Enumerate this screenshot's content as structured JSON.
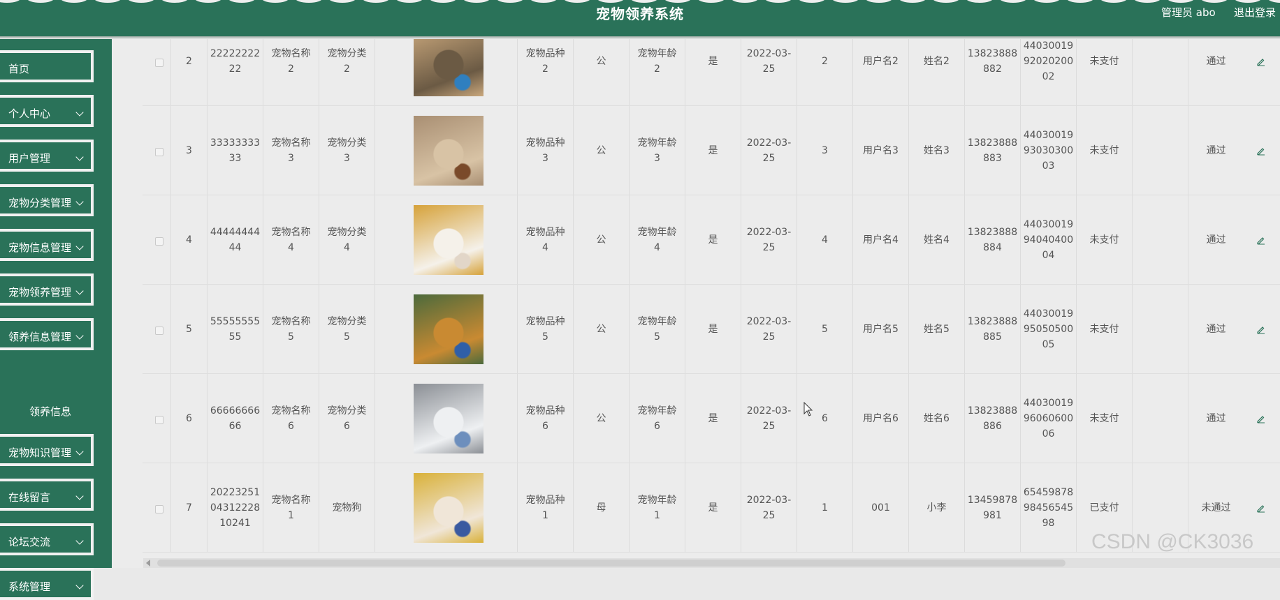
{
  "header": {
    "title": "宠物领养系统",
    "user_label": "管理员 abo",
    "logout_label": "退出登录",
    "bg_color": "#2a7259"
  },
  "sidebar": {
    "items": [
      {
        "label": "首页",
        "has_chevron": false
      },
      {
        "label": "个人中心",
        "has_chevron": true
      },
      {
        "label": "用户管理",
        "has_chevron": true
      },
      {
        "label": "宠物分类管理",
        "has_chevron": true
      },
      {
        "label": "宠物信息管理",
        "has_chevron": true
      },
      {
        "label": "宠物领养管理",
        "has_chevron": true
      },
      {
        "label": "领养信息管理",
        "has_chevron": true
      },
      {
        "label": "宠物知识管理",
        "has_chevron": true
      },
      {
        "label": "在线留言",
        "has_chevron": true
      },
      {
        "label": "论坛交流",
        "has_chevron": true
      },
      {
        "label": "系统管理",
        "has_chevron": true
      }
    ],
    "sub_item": "领养信息"
  },
  "table": {
    "rows": [
      {
        "idx": "2",
        "no": "22222222\n22",
        "name": "宠物名称\n2",
        "category": "宠物分类\n2",
        "image": "dog-ball-photo",
        "breed": "宠物品种\n2",
        "sex": "公",
        "age": "宠物年龄\n2",
        "vaccinated": "是",
        "date": "2022-03-\n25",
        "count": "2",
        "username": "用户名2",
        "realname": "姓名2",
        "phone": "13823888\n882",
        "idcard": "44030019\n92020200\n02",
        "pay": "未支付",
        "review": "通过"
      },
      {
        "idx": "3",
        "no": "33333333\n33",
        "name": "宠物名称\n3",
        "category": "宠物分类\n3",
        "image": "dog-sleeping-photo",
        "breed": "宠物品种\n3",
        "sex": "公",
        "age": "宠物年龄\n3",
        "vaccinated": "是",
        "date": "2022-03-\n25",
        "count": "3",
        "username": "用户名3",
        "realname": "姓名3",
        "phone": "13823888\n883",
        "idcard": "44030019\n93030300\n03",
        "pay": "未支付",
        "review": "通过"
      },
      {
        "idx": "4",
        "no": "44444444\n44",
        "name": "宠物名称\n4",
        "category": "宠物分类\n4",
        "image": "white-poodle-photo",
        "breed": "宠物品种\n4",
        "sex": "公",
        "age": "宠物年龄\n4",
        "vaccinated": "是",
        "date": "2022-03-\n25",
        "count": "4",
        "username": "用户名4",
        "realname": "姓名4",
        "phone": "13823888\n884",
        "idcard": "44030019\n94040400\n04",
        "pay": "未支付",
        "review": "通过"
      },
      {
        "idx": "5",
        "no": "55555555\n55",
        "name": "宠物名称\n5",
        "category": "宠物分类\n5",
        "image": "golden-retriever-photo",
        "breed": "宠物品种\n5",
        "sex": "公",
        "age": "宠物年龄\n5",
        "vaccinated": "是",
        "date": "2022-03-\n25",
        "count": "5",
        "username": "用户名5",
        "realname": "姓名5",
        "phone": "13823888\n885",
        "idcard": "44030019\n95050500\n05",
        "pay": "未支付",
        "review": "通过"
      },
      {
        "idx": "6",
        "no": "66666666\n66",
        "name": "宠物名称\n6",
        "category": "宠物分类\n6",
        "image": "white-dog-walking-photo",
        "breed": "宠物品种\n6",
        "sex": "公",
        "age": "宠物年龄\n6",
        "vaccinated": "是",
        "date": "2022-03-\n25",
        "count": "6",
        "username": "用户名6",
        "realname": "姓名6",
        "phone": "13823888\n886",
        "idcard": "44030019\n96060600\n06",
        "pay": "未支付",
        "review": "通过"
      },
      {
        "idx": "7",
        "no": "20223251\n04312228\n10241",
        "name": "宠物名称\n1",
        "category": "宠物狗",
        "image": "shiba-yellow-hat-photo",
        "breed": "宠物品种\n1",
        "sex": "母",
        "age": "宠物年龄\n1",
        "vaccinated": "是",
        "date": "2022-03-\n25",
        "count": "1",
        "username": "001",
        "realname": "小李",
        "phone": "13459878\n981",
        "idcard": "65459878\n98456545\n98",
        "pay": "已支付",
        "review": "未通过"
      }
    ]
  },
  "watermark": "CSDN @CK3036",
  "colors": {
    "accent": "#2a7259",
    "background": "#ececec",
    "text": "#555555",
    "edit_icon": "#2a7259"
  }
}
